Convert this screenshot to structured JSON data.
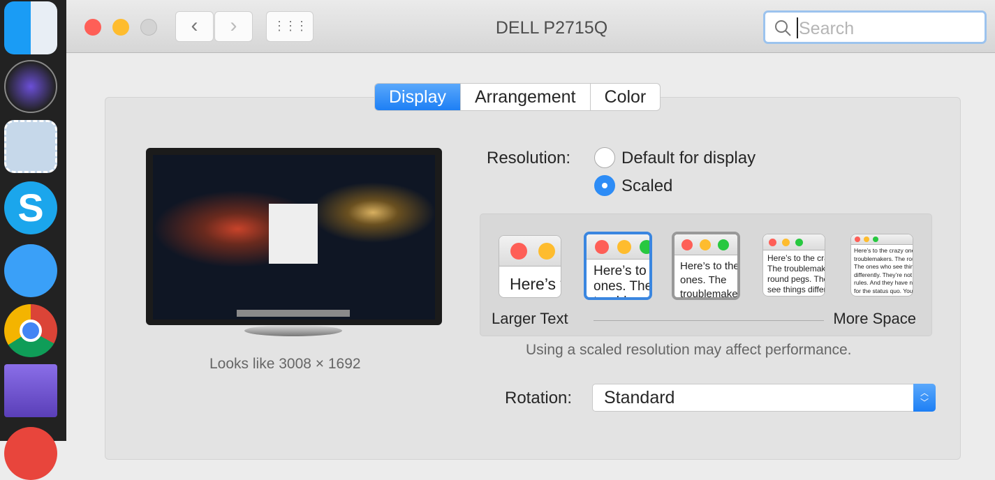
{
  "window": {
    "title": "DELL P2715Q"
  },
  "toolbar": {
    "back": "‹",
    "forward": "›",
    "grid": "⋮⋮⋮",
    "search_placeholder": "Search"
  },
  "tabs": [
    {
      "label": "Display"
    },
    {
      "label": "Arrangement"
    },
    {
      "label": "Color"
    }
  ],
  "display": {
    "looks_like": "Looks like 3008 × 1692"
  },
  "resolution": {
    "label": "Resolution:",
    "options": [
      {
        "label": "Default for display",
        "selected": false
      },
      {
        "label": "Scaled",
        "selected": true
      }
    ]
  },
  "scaling": {
    "preview_text": "Here’s to the crazy ones. The troublemakers. The round pegs. The ones who see things differently. They’re not fond of rules. And they have no respect for the status quo. You can quote them, disagree with them. About the only thing you can’t do is ignore them. Because they change things.",
    "larger_label": "Larger Text",
    "more_label": "More Space",
    "selected_index": 1,
    "warning": "Using a scaled resolution may affect performance."
  },
  "rotation": {
    "label": "Rotation:",
    "value": "Standard"
  },
  "colors": {
    "accent": "#1d7ff5",
    "close": "#fe5f57",
    "minimize": "#febc2e",
    "zoom": "#28c840"
  }
}
